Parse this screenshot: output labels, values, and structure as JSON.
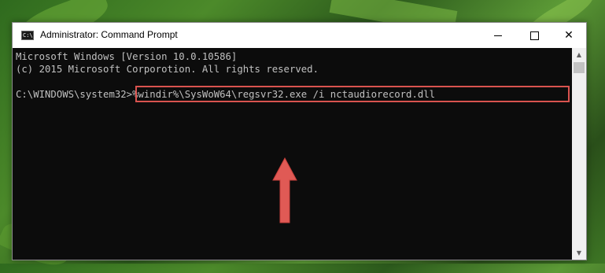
{
  "window": {
    "title": "Administrator: Command Prompt",
    "icon_label": "C:\\",
    "controls": {
      "minimize_icon": "minimize-icon",
      "maximize_icon": "maximize-icon",
      "close_glyph": "✕"
    }
  },
  "console": {
    "lines": [
      "Microsoft Windows [Version 10.0.10586]",
      "(c) 2015 Microsoft Corporotion. All rights reserved."
    ],
    "prompt": "C:\\WINDOWS\\system32>",
    "command": "%windir%\\SysWoW64\\regsvr32.exe /i nctaudiorecord.dll"
  },
  "scrollbar": {
    "up_glyph": "▲",
    "down_glyph": "▼"
  },
  "colors": {
    "console_bg": "#0c0c0c",
    "console_text": "#c0c0c0",
    "highlight": "#d9534f"
  }
}
